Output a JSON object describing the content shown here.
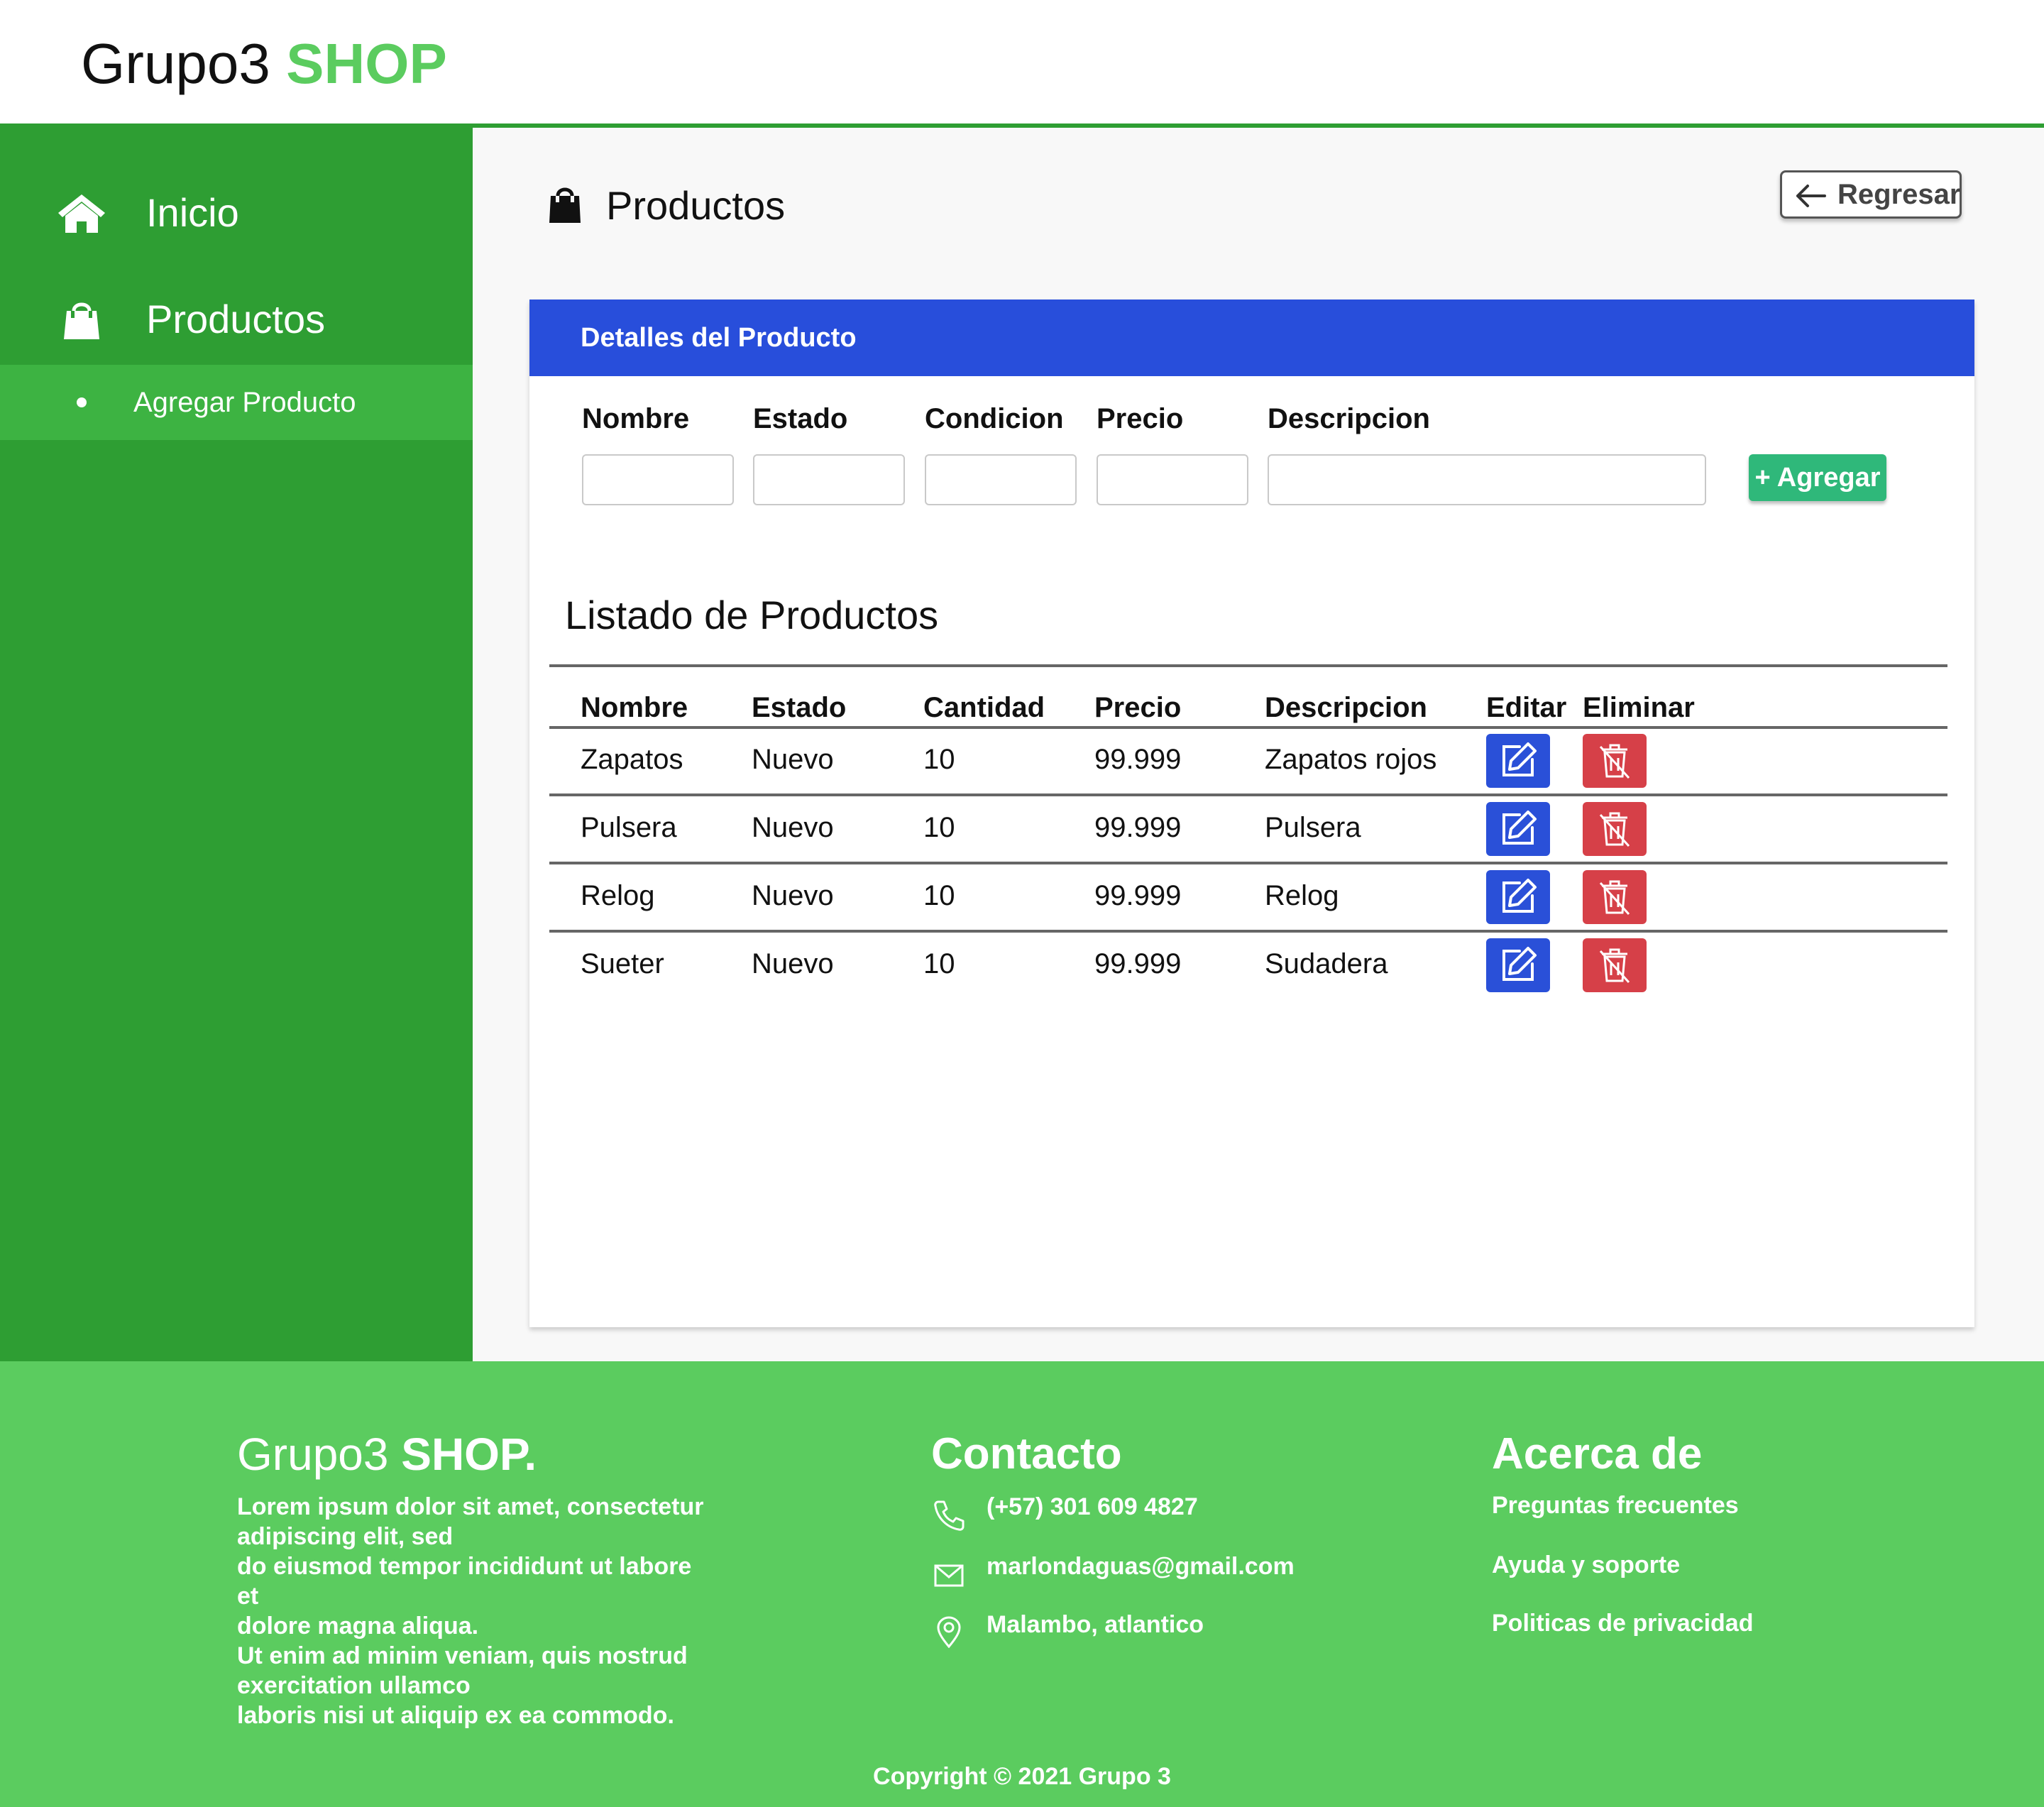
{
  "brand": {
    "name": "Grupo3",
    "accent": "SHOP"
  },
  "sidebar": {
    "items": [
      {
        "label": "Inicio",
        "icon": "home-icon"
      },
      {
        "label": "Productos",
        "icon": "shopping-bag-icon"
      }
    ],
    "sub_items": [
      {
        "label": "Agregar Producto"
      }
    ]
  },
  "page": {
    "title": "Productos",
    "icon": "shopping-bag-icon",
    "back_label": "Regresar"
  },
  "form": {
    "header": "Detalles del Producto",
    "labels": [
      "Nombre",
      "Estado",
      "Condicion",
      "Precio",
      "Descripcion"
    ],
    "values": [
      "",
      "",
      "",
      "",
      ""
    ],
    "add_label": "+ Agregar"
  },
  "list": {
    "title": "Listado de Productos",
    "columns": [
      "Nombre",
      "Estado",
      "Cantidad",
      "Precio",
      "Descripcion",
      "Editar",
      "Eliminar"
    ],
    "rows": [
      [
        "Zapatos",
        "Nuevo",
        "10",
        "99.999",
        "Zapatos rojos"
      ],
      [
        "Pulsera",
        "Nuevo",
        "10",
        "99.999",
        "Pulsera"
      ],
      [
        "Relog",
        "Nuevo",
        "10",
        "99.999",
        "Relog"
      ],
      [
        "Sueter",
        "Nuevo",
        "10",
        "99.999",
        "Sudadera"
      ]
    ]
  },
  "footer": {
    "brand": {
      "name": "Grupo3",
      "accent": "SHOP."
    },
    "about_lines": [
      "Lorem ipsum dolor sit amet, consectetur",
      "adipiscing elit, sed",
      "do eiusmod tempor incididunt ut labore et",
      "dolore magna aliqua.",
      "Ut enim ad minim veniam, quis nostrud",
      "exercitation ullamco",
      "laboris nisi ut aliquip ex ea commodo."
    ],
    "contact": {
      "heading": "Contacto",
      "phone": "(+57) 301 609 4827",
      "email": "marlondaguas@gmail.com",
      "location": "Malambo, atlantico"
    },
    "about": {
      "heading": "Acerca de",
      "links": [
        "Preguntas frecuentes",
        "Ayuda y soporte",
        "Politicas de privacidad"
      ]
    },
    "copyright": "Copyright © 2021 Grupo 3"
  },
  "colors": {
    "sidebar": "#2e9e33",
    "sidebar_active": "#3db342",
    "footer": "#5bcc5f",
    "card_header": "#284edb",
    "add_button": "#2fb87a",
    "edit_button": "#2a50d8",
    "delete_button": "#d64048"
  }
}
